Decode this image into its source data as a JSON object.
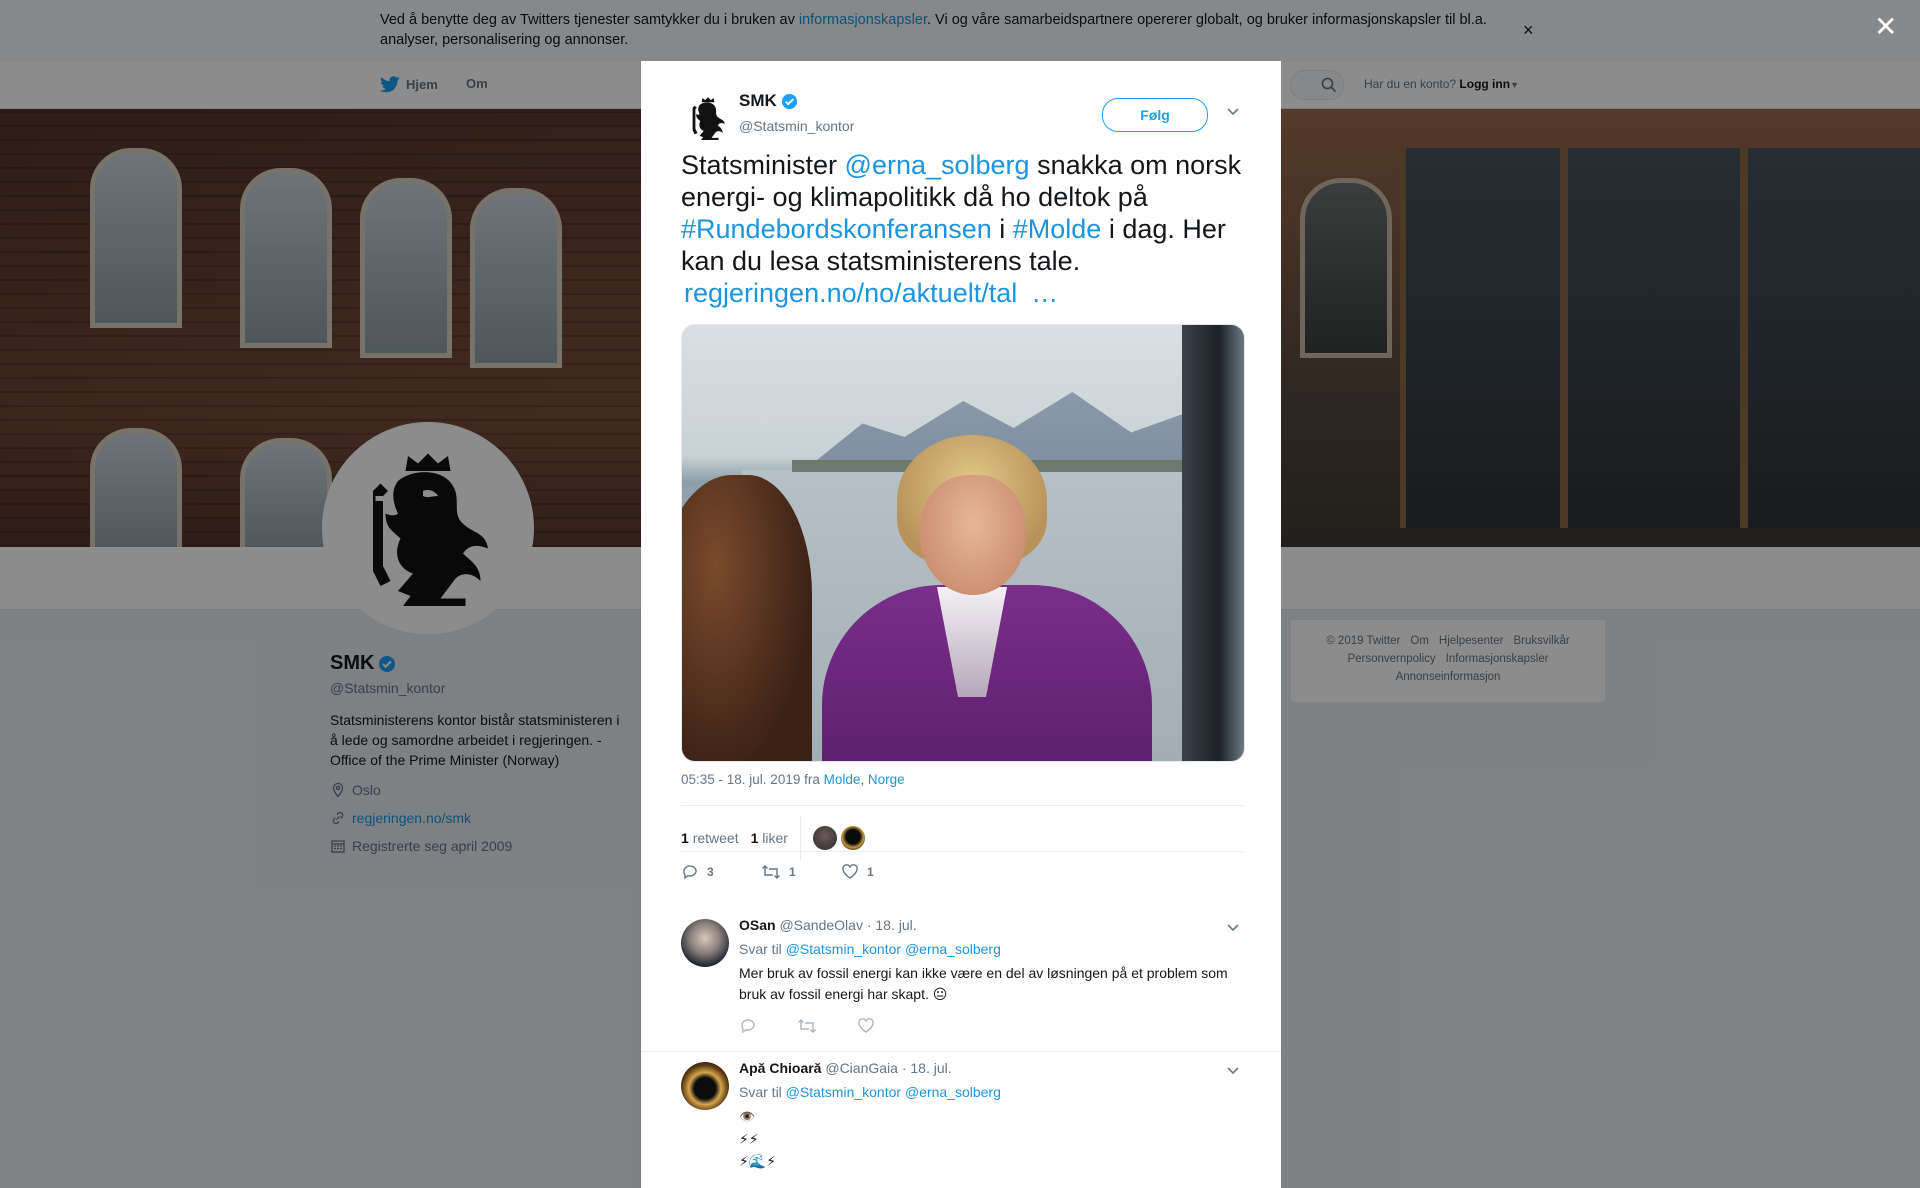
{
  "cookie_bar": {
    "text_before": "Ved å benytte deg av Twitters tjenester samtykker du i bruken av ",
    "link": "informasjonskapsler",
    "text_after": ". Vi og våre samarbeidspartnere opererer globalt, og bruker informasjonskapsler til bl.a. analyser, personalisering og annonser.",
    "close": "×"
  },
  "nav": {
    "home": "Hjem",
    "about": "Om",
    "have_account": "Har du en konto?",
    "login": "Logg inn"
  },
  "profile": {
    "name": "SMK",
    "handle": "@Statsmin_kontor",
    "bio": "Statsministerens kontor bistår statsministeren i å lede og samordne arbeidet i regjeringen. - Office of the Prime Minister (Norway)",
    "location": "Oslo",
    "website": "regjeringen.no/smk",
    "joined": "Registrerte seg april 2009"
  },
  "footer": {
    "links": [
      "© 2019 Twitter",
      "Om",
      "Hjelpesenter",
      "Bruksvilkår",
      "Personvernpolicy",
      "Informasjonskapsler",
      "Annonseinformasjon"
    ]
  },
  "overlay": {
    "close": "✕"
  },
  "tweet": {
    "author_name": "SMK",
    "author_handle": "@Statsmin_kontor",
    "follow_label": "Følg",
    "text": {
      "p1": "Statsminister ",
      "mention": "@erna_solberg",
      "p2": " snakka om norsk energi- og klimapolitikk då ho deltok på ",
      "hashtag1": "#Rundebordskonferansen",
      "p3": " i ",
      "hashtag2": "#Molde",
      "p4": " i dag. Her kan du lesa statsministerens tale.",
      "url": "regjeringen.no/no/aktuelt/tal",
      "ellipsis": "…"
    },
    "timestamp": "05:35 - 18. jul. 2019 fra ",
    "place": "Molde, Norge",
    "retweets_count": "1",
    "retweets_label": "retweet",
    "likes_count": "1",
    "likes_label": "liker",
    "actions": {
      "replies": "3",
      "retweets": "1",
      "likes": "1"
    }
  },
  "replies": [
    {
      "name": "OSan",
      "handle": "@SandeOlav",
      "date": "· 18. jul.",
      "reply_to_label": "Svar til",
      "reply_to": "@Statsmin_kontor @erna_solberg",
      "text": "Mer bruk av fossil energi kan ikke være en del av løsningen på et problem som bruk av fossil energi har skapt. 😐"
    },
    {
      "name": "Apă Chioară",
      "handle": "@CianGaia",
      "date": "· 18. jul.",
      "reply_to_label": "Svar til",
      "reply_to": "@Statsmin_kontor @erna_solberg",
      "lines": [
        "👁️",
        "⚡⚡",
        "⚡🌊⚡"
      ]
    }
  ],
  "colors": {
    "link": "#1b95e0",
    "accent": "#1da1f2",
    "muted": "#657786",
    "verified": "#1da1f2"
  },
  "icons": [
    "twitter-bird-icon",
    "search-icon",
    "location-icon",
    "link-icon",
    "calendar-icon",
    "verified-icon",
    "chevron-down-icon",
    "reply-icon",
    "retweet-icon",
    "like-icon",
    "close-icon"
  ]
}
